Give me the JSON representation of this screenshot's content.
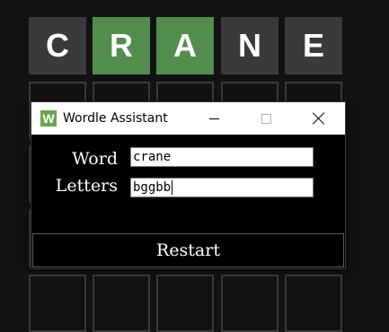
{
  "board": {
    "first_row": [
      {
        "letter": "C",
        "state": "absent"
      },
      {
        "letter": "R",
        "state": "correct"
      },
      {
        "letter": "A",
        "state": "correct"
      },
      {
        "letter": "N",
        "state": "absent"
      },
      {
        "letter": "E",
        "state": "absent"
      }
    ],
    "colors": {
      "absent": "#3a3a3c",
      "correct": "#538d4e",
      "background": "#121213"
    }
  },
  "window": {
    "title": "Wordle Assistant",
    "icon_letter": "W",
    "icon_color": "#6aa64a",
    "word_label": "Word",
    "letters_label": "Letters",
    "word_value": "crane",
    "letters_value": "bggbb",
    "restart_label": "Restart"
  }
}
